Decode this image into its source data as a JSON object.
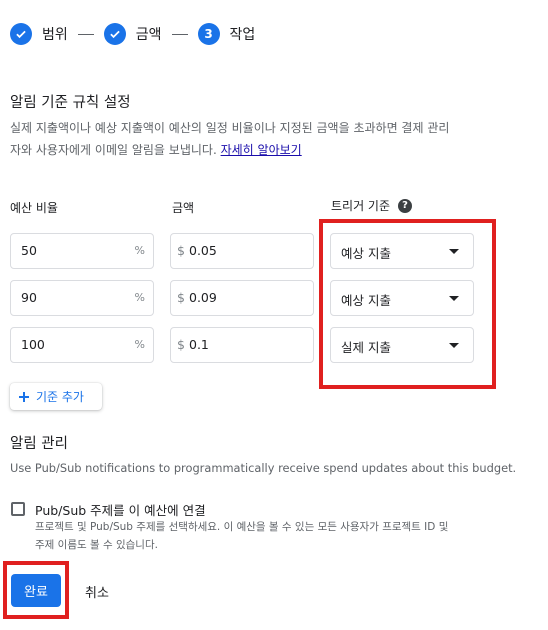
{
  "stepper": {
    "steps": [
      {
        "label": "범위",
        "state": "done",
        "icon": "check-icon"
      },
      {
        "label": "금액",
        "state": "done",
        "icon": "check-icon"
      },
      {
        "label": "작업",
        "state": "current",
        "number": "3"
      }
    ]
  },
  "alert_rules": {
    "title": "알림 기준 규칙 설정",
    "description": "실제 지출액이나 예상 지출액이 예산의 일정 비율이나 지정된 금액을 초과하면 결제 관리",
    "description_line2": "자와 사용자에게 이메일 알림을 보냅니다.",
    "learn_more": "자세히 알아보기",
    "headers": {
      "percent": "예산 비율",
      "amount": "금액",
      "trigger": "트리거 기준"
    },
    "rows": [
      {
        "percent": "50",
        "percent_suffix": "%",
        "currency": "$",
        "amount": "0.05",
        "trigger": "예상 지출"
      },
      {
        "percent": "90",
        "percent_suffix": "%",
        "currency": "$",
        "amount": "0.09",
        "trigger": "예상 지출"
      },
      {
        "percent": "100",
        "percent_suffix": "%",
        "currency": "$",
        "amount": "0.1",
        "trigger": "실제 지출"
      }
    ],
    "add_label": "기준 추가"
  },
  "manage": {
    "title": "알림 관리",
    "description": "Use Pub/Sub notifications to programmatically receive spend updates about this budget.",
    "checkbox_label": "Pub/Sub 주제를 이 예산에 연결",
    "checkbox_checked": false,
    "checkbox_help": "프로젝트 및 Pub/Sub 주제를 선택하세요. 이 예산을 볼 수 있는 모든 사용자가 프로젝트 ID 및",
    "checkbox_help_line2": "주제 이름도 볼 수 있습니다."
  },
  "footer": {
    "done_label": "완료",
    "cancel_label": "취소"
  },
  "colors": {
    "accent": "#1a73e8",
    "highlight": "#e0201f"
  }
}
